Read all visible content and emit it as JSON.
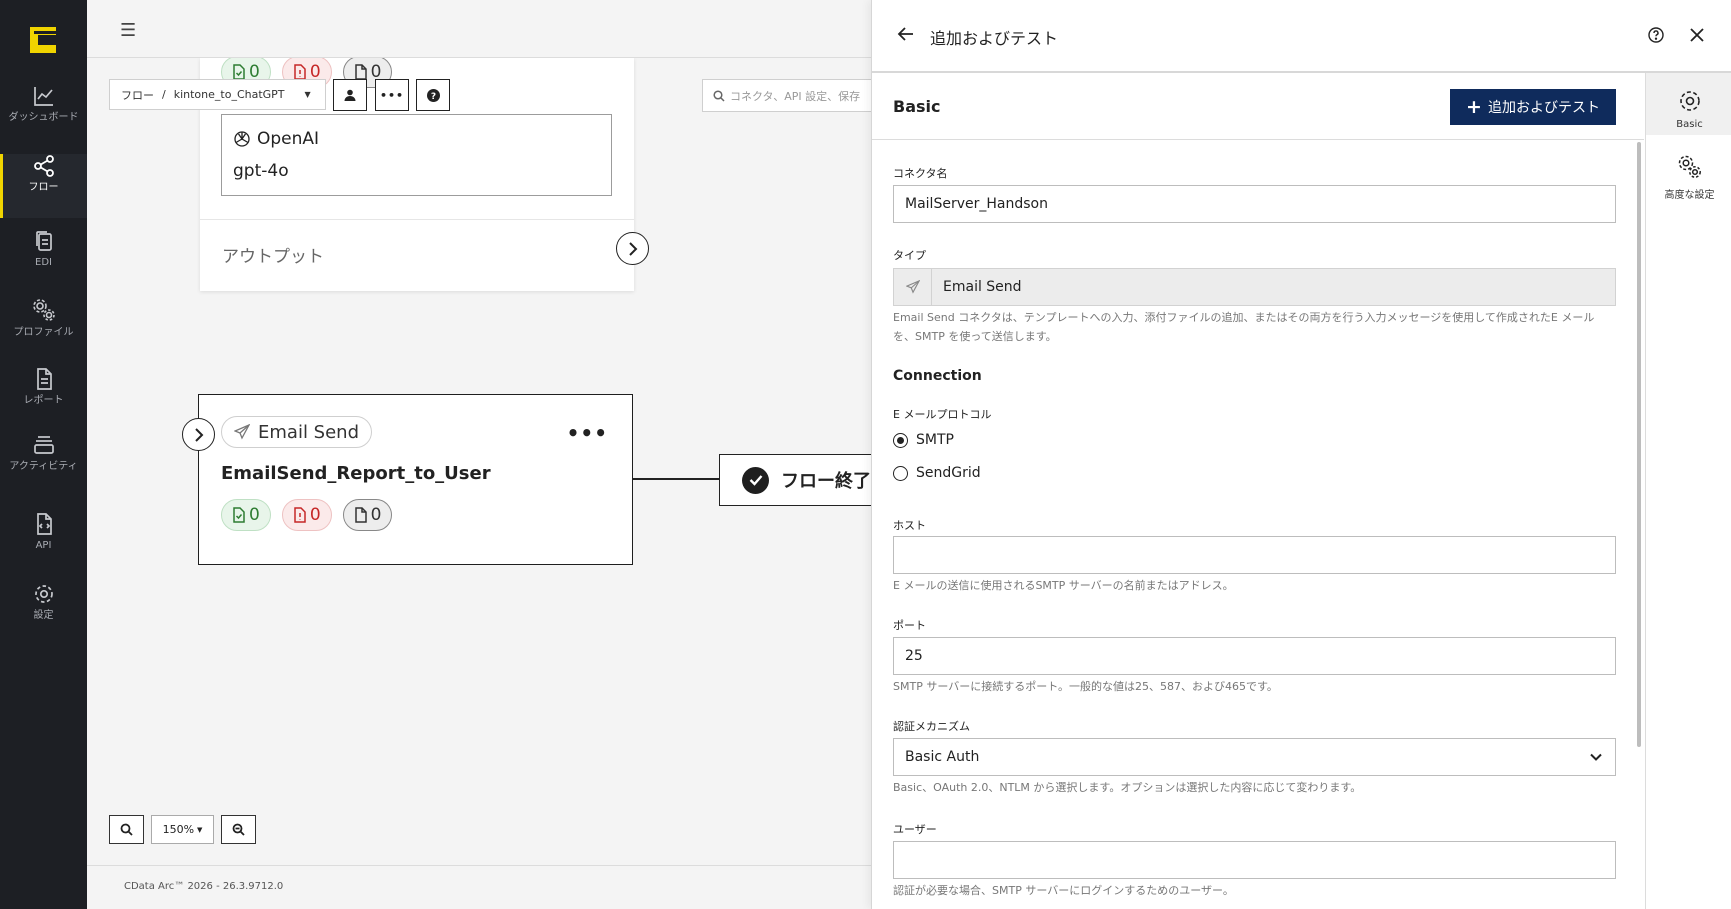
{
  "app": {
    "footer": "CData Arc™ 2026 - 26.3.9712.0"
  },
  "nav": {
    "items": [
      {
        "label": "ダッシュボード",
        "icon": "chart-line-icon"
      },
      {
        "label": "フロー",
        "icon": "flow-share-icon",
        "active": true
      },
      {
        "label": "EDI",
        "icon": "documents-icon"
      },
      {
        "label": "プロファイル",
        "icon": "gears-icon"
      },
      {
        "label": "レポート",
        "icon": "report-icon"
      },
      {
        "label": "アクティビティ",
        "icon": "activity-stack-icon"
      },
      {
        "label": "API",
        "icon": "api-file-icon"
      },
      {
        "label": "設定",
        "icon": "settings-gear-icon"
      }
    ]
  },
  "toolbar": {
    "breadcrumb_root": "フロー",
    "breadcrumb_separator": "/",
    "flow_name": "kintone_to_ChatGPT",
    "search_placeholder": "コネクタ、API 設定、保存"
  },
  "canvas": {
    "top_card": {
      "counts": {
        "success": "0",
        "error": "0",
        "pending": "0"
      },
      "provider": "OpenAI",
      "model": "gpt-4o",
      "output_label": "アウトプット"
    },
    "email_card": {
      "type_label": "Email Send",
      "name": "EmailSend_Report_to_User",
      "counts": {
        "success": "0",
        "error": "0",
        "pending": "0"
      }
    },
    "flow_end_label": "フロー終了",
    "zoom": "150%"
  },
  "panel": {
    "title": "追加およびテスト",
    "section": "Basic",
    "submit_label": "追加およびテスト",
    "tabs": [
      {
        "label": "Basic",
        "icon": "gear-icon",
        "active": true
      },
      {
        "label": "高度な設定",
        "icon": "gears-icon"
      }
    ],
    "fields": {
      "connector_name": {
        "label": "コネクタ名",
        "value": "MailServer_Handson"
      },
      "type": {
        "label": "タイプ",
        "value": "Email Send",
        "help": "Email Send コネクタは、テンプレートへの入力、添付ファイルの追加、またはその両方を行う入力メッセージを使用して作成されたE メールを、SMTP を使って送信します。"
      },
      "connection_title": "Connection",
      "protocol": {
        "label": "E メールプロトコル",
        "options": [
          "SMTP",
          "SendGrid"
        ],
        "selected": "SMTP"
      },
      "host": {
        "label": "ホスト",
        "value": "",
        "help": "E メールの送信に使用されるSMTP サーバーの名前またはアドレス。"
      },
      "port": {
        "label": "ポート",
        "value": "25",
        "help": "SMTP サーバーに接続するポート。一般的な値は25、587、および465です。"
      },
      "auth": {
        "label": "認証メカニズム",
        "value": "Basic Auth",
        "help": "Basic、OAuth 2.0、NTLM から選択します。オプションは選択した内容に応じて変わります。"
      },
      "user": {
        "label": "ユーザー",
        "value": "",
        "help": "認証が必要な場合、SMTP サーバーにログインするためのユーザー。"
      }
    }
  },
  "colors": {
    "accent_yellow": "#f0d400",
    "primary_navy": "#0f2b5c",
    "nav_bg": "#1d1f24"
  }
}
